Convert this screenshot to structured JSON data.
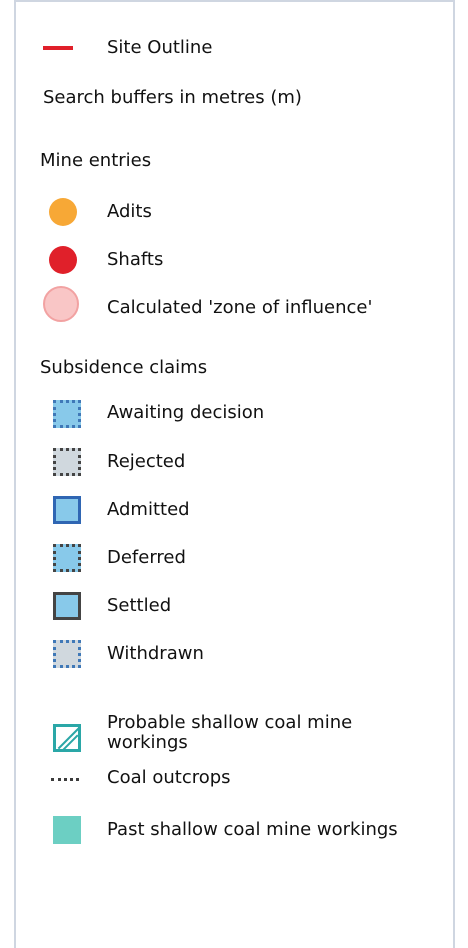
{
  "legend": {
    "site_outline": "Site Outline",
    "search_buffers": "Search buffers in metres (m)",
    "mine_entries_heading": "Mine entries",
    "adits": "Adits",
    "shafts": "Shafts",
    "zone_of_influence": "Calculated 'zone of influence'",
    "subsidence_claims_heading": "Subsidence claims",
    "awaiting_decision": "Awaiting decision",
    "rejected": "Rejected",
    "admitted": "Admitted",
    "deferred": "Deferred",
    "settled": "Settled",
    "withdrawn": "Withdrawn",
    "probable_shallow_line1": "Probable shallow coal mine",
    "probable_shallow_line2": "workings",
    "coal_outcrops": "Coal outcrops",
    "past_shallow": "Past shallow coal mine workings"
  },
  "colors": {
    "site_outline": "#e0202a",
    "adit": "#f7a836",
    "shaft": "#e0202a",
    "zone_fill": "#f9c6c6",
    "zone_border": "#f2a2a2",
    "claim_blue": "#88c9ea",
    "claim_grey": "#d0d8de",
    "teal": "#6ccfc3",
    "hatch_teal": "#2aa7a7"
  }
}
